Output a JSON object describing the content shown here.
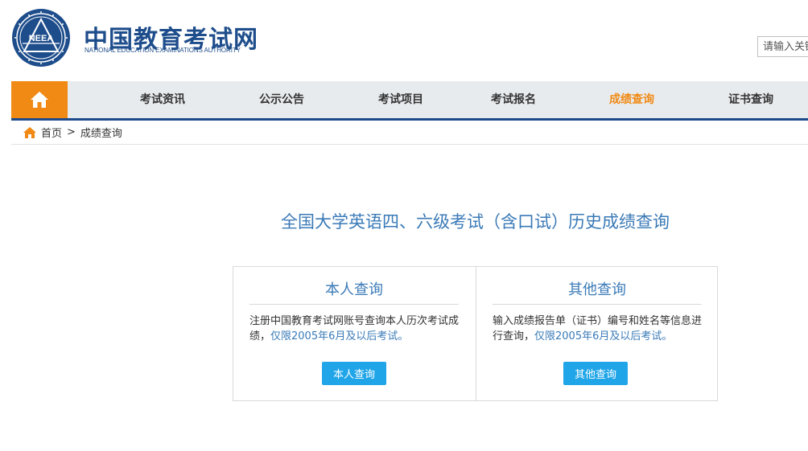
{
  "header": {
    "site_title": "中国教育考试网",
    "site_subtitle": "NATIONAL EDUCATION EXAMINATIONS AUTHORITY",
    "logo_text": "NEEA",
    "search_placeholder": "请输入关键"
  },
  "nav": {
    "home_icon": "home-icon",
    "items": [
      {
        "label": "考试资讯",
        "active": false
      },
      {
        "label": "公示公告",
        "active": false
      },
      {
        "label": "考试项目",
        "active": false
      },
      {
        "label": "考试报名",
        "active": false
      },
      {
        "label": "成绩查询",
        "active": true
      },
      {
        "label": "证书查询",
        "active": false
      }
    ],
    "colors": {
      "home_bg": "#f08a15",
      "active": "#f08a15",
      "bar_border": "#1d4b8a"
    }
  },
  "breadcrumb": {
    "home": "首页",
    "separator": ">",
    "current": "成绩查询"
  },
  "main": {
    "title": "全国大学英语四、六级考试（含口试）历史成绩查询",
    "cards": [
      {
        "title": "本人查询",
        "desc": "注册中国教育考试网账号查询本人历次考试成绩，",
        "highlight": "仅限2005年6月及以后考试。",
        "button": "本人查询"
      },
      {
        "title": "其他查询",
        "desc": "输入成绩报告单（证书）编号和姓名等信息进行查询，",
        "highlight": "仅限2005年6月及以后考试。",
        "button": "其他查询"
      }
    ],
    "colors": {
      "accent": "#3a7ab7",
      "button": "#1fa5e8"
    }
  }
}
